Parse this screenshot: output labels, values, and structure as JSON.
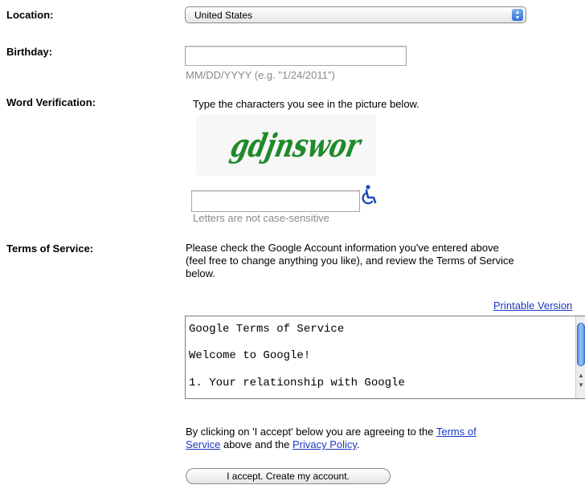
{
  "location": {
    "label": "Location:",
    "value": "United States"
  },
  "birthday": {
    "label": "Birthday:",
    "value": "",
    "hint": "MM/DD/YYYY (e.g. \"1/24/2011\")"
  },
  "word_verification": {
    "label": "Word Verification:",
    "instruction": "Type the characters you see in the picture below.",
    "captcha_text": "gdjnswor",
    "value": "",
    "hint": "Letters are not case-sensitive"
  },
  "terms": {
    "label": "Terms of Service:",
    "intro_lines": [
      "Please check the Google Account information you've entered above",
      "(feel free to change anything you like), and review the Terms of Service",
      "below."
    ],
    "printable_link": "Printable Version",
    "box_lines": [
      "Google Terms of Service",
      "Welcome to Google!",
      "1. Your relationship with Google"
    ],
    "agree_prefix": "By clicking on 'I accept' below you are agreeing to the ",
    "agree_tos_link": "Terms of Service",
    "agree_middle": " above and the ",
    "agree_privacy_link": "Privacy Policy",
    "agree_suffix": "."
  },
  "accept_button": "I accept. Create my account.",
  "colors": {
    "link": "#1b38c4",
    "captcha": "#1f8a2a",
    "accessibility": "#1a4fb5"
  }
}
